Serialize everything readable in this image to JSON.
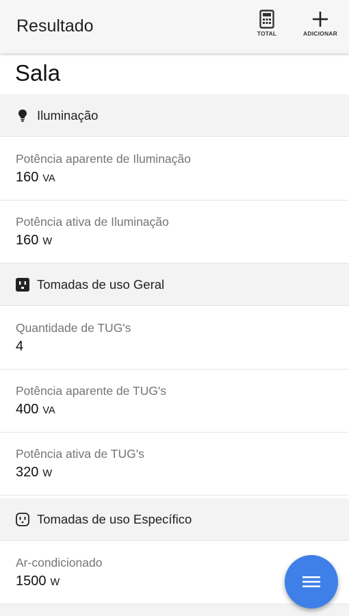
{
  "appbar": {
    "title": "Resultado",
    "actions": [
      {
        "label": "TOTAL",
        "icon": "calculator-icon"
      },
      {
        "label": "ADICIONAR",
        "icon": "plus-icon"
      }
    ]
  },
  "room": {
    "title": "Sala"
  },
  "sections": [
    {
      "title": "Iluminação",
      "icon": "lightbulb-icon",
      "items": [
        {
          "label": "Potência aparente de Iluminação",
          "value": "160",
          "unit": "VA"
        },
        {
          "label": "Potência ativa de Iluminação",
          "value": "160",
          "unit": "W"
        }
      ]
    },
    {
      "title": "Tomadas de uso Geral",
      "icon": "power-outlet-icon",
      "items": [
        {
          "label": "Quantidade de TUG's",
          "value": "4",
          "unit": ""
        },
        {
          "label": "Potência aparente de TUG's",
          "value": "400",
          "unit": "VA"
        },
        {
          "label": "Potência ativa de TUG's",
          "value": "320",
          "unit": "W"
        }
      ]
    },
    {
      "title": "Tomadas de uso Específico",
      "icon": "outlet-outline-icon",
      "items": [
        {
          "label": "Ar-condicionado",
          "value": "1500",
          "unit": "W"
        }
      ]
    }
  ],
  "fab": {
    "icon": "menu-icon"
  },
  "colors": {
    "fab": "#3f7fe8",
    "appbar": "#f6f6f6",
    "section_header": "#f3f3f3",
    "label": "#757575"
  }
}
